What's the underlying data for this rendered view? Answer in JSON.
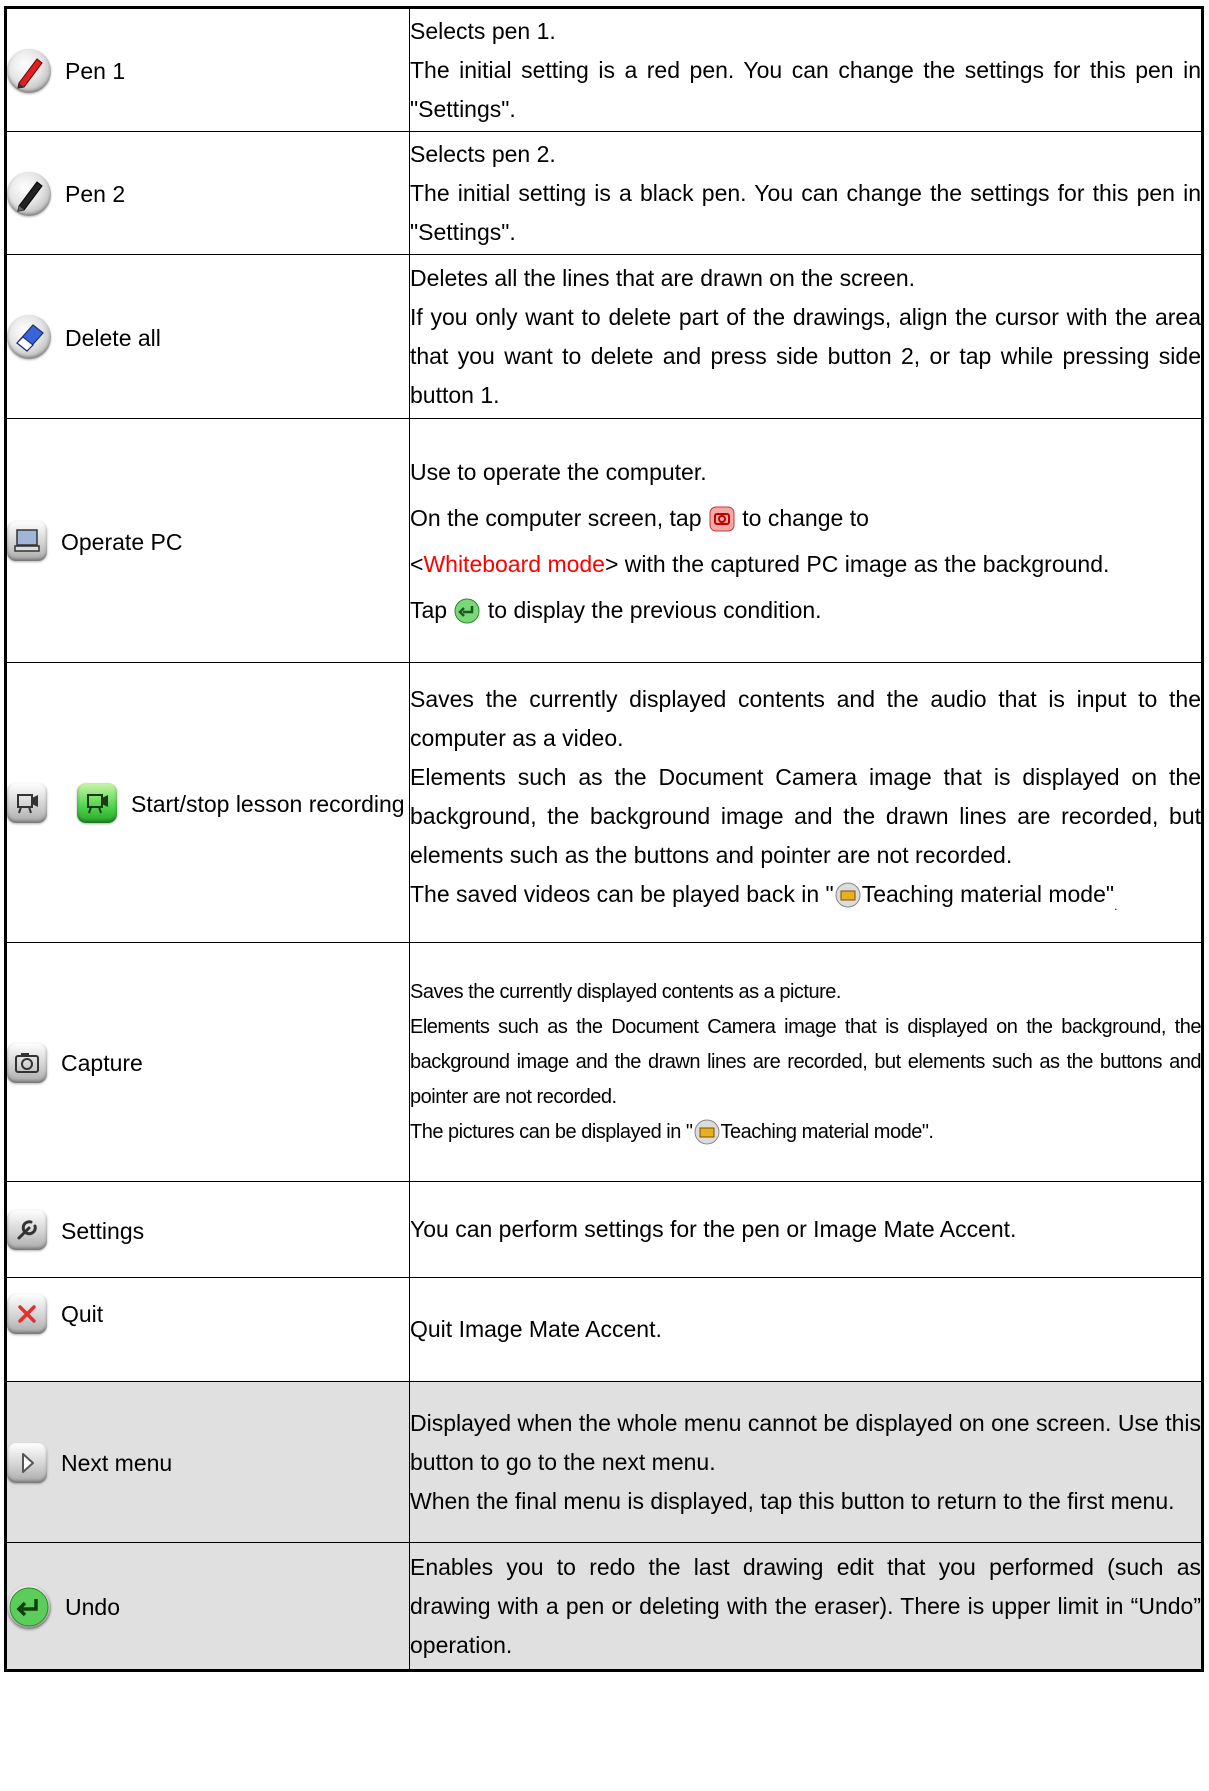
{
  "rows": [
    {
      "label": "Pen 1",
      "icon": "red-pen-icon",
      "desc": [
        "Selects pen 1.",
        "The initial setting is a red pen. You can change the settings for this pen in \"Settings\"."
      ]
    },
    {
      "label": "Pen 2",
      "icon": "black-pen-icon",
      "desc": [
        "Selects pen 2.",
        "The initial setting is a black pen. You can change the settings for this pen in \"Settings\"."
      ]
    },
    {
      "label": "Delete all",
      "icon": "eraser-icon",
      "desc": [
        "Deletes all the lines that are drawn on the screen.",
        "If you only want to delete part of the drawings, align the cursor with the area that you want to delete and press side button 2, or tap while pressing side button 1."
      ]
    },
    {
      "label": "Operate PC",
      "icon": "computer-icon",
      "desc": {
        "line1": "Use to operate the computer.",
        "line2_before": "On the computer screen, tap",
        "line2_after": "to change to",
        "mode_open": "<",
        "mode_text": "Whiteboard mode",
        "mode_close": ">",
        "line2_rest": " with the captured PC image as the background.",
        "line3_before": "Tap",
        "line3_after": "to display the previous condition."
      }
    },
    {
      "label": "Start/stop lesson recording",
      "icon": "recording-icon",
      "desc": {
        "p1": "Saves the currently displayed contents and the audio that is input to the computer as a video.",
        "p2": "Elements such as the Document Camera image that is displayed on the background, the background image and the drawn lines are recorded, but elements such as the buttons and pointer are not recorded.",
        "p3_before": "The saved videos can be played back in \"",
        "p3_link": "Teaching material mode\"",
        "p3_end": "."
      }
    },
    {
      "label": "Capture",
      "icon": "camera-icon",
      "desc": {
        "p1": "Saves the currently displayed contents as a picture.",
        "p2": "Elements such as the Document Camera image that is displayed on the background, the background image and the drawn lines are recorded, but elements such as the buttons and pointer are not recorded.",
        "p3_before": "The pictures can be displayed in \"",
        "p3_link": "Teaching material mode\"."
      }
    },
    {
      "label": "Settings",
      "icon": "wrench-icon",
      "desc": [
        "You can perform settings for the pen or Image Mate Accent."
      ]
    },
    {
      "label": "Quit",
      "icon": "close-icon",
      "desc": [
        "Quit Image Mate Accent."
      ]
    },
    {
      "label": "Next menu",
      "icon": "next-arrow-icon",
      "desc": [
        "Displayed when the whole menu cannot be displayed on one screen. Use this button to go to the next menu.",
        "When the final menu is displayed, tap this button to return to the first menu."
      ]
    },
    {
      "label": "Undo",
      "icon": "undo-icon",
      "desc": [
        "Enables you to redo the last drawing edit that you performed (such as drawing with a pen or deleting with the eraser). There is upper limit in “Undo” operation."
      ]
    }
  ],
  "colors": {
    "highlight": "#ff0000",
    "shaded_row": "#e0e0e0",
    "border": "#000000"
  }
}
